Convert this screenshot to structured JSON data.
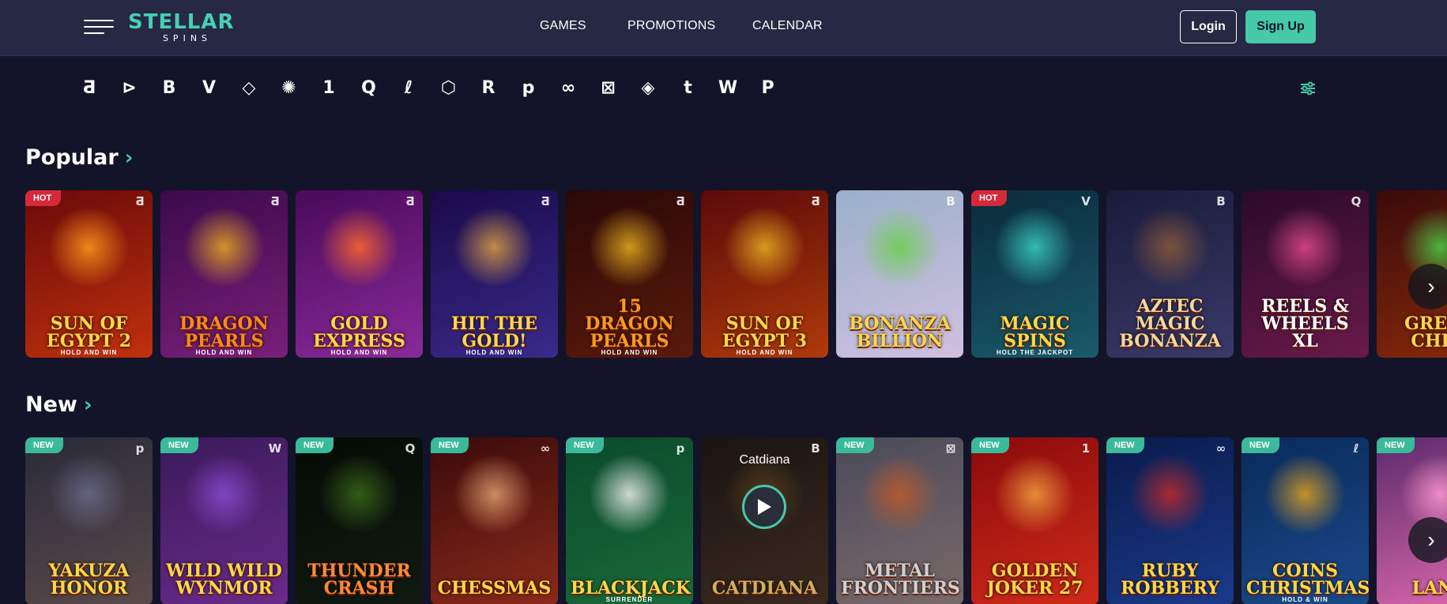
{
  "header": {
    "logo_top": "STELLAR",
    "logo_bottom": "SPINS",
    "nav": [
      "GAMES",
      "PROMOTIONS",
      "CALENDAR"
    ],
    "login_label": "Login",
    "signup_label": "Sign Up"
  },
  "providers": [
    "Ƌ",
    "⊳",
    "B",
    "V",
    "◇",
    "✺",
    "1",
    "Q",
    "ℓ",
    "⬡",
    "R",
    "p",
    "∞",
    "⊠",
    "◈",
    "t",
    "W",
    "P"
  ],
  "popular": {
    "title": "Popular",
    "chevron": "›",
    "games": [
      {
        "name": "SUN OF EGYPT 2",
        "sub": "HOLD AND WIN",
        "badge": "HOT",
        "provider": "Ƌ",
        "bg": [
          "#6a0a0a",
          "#c0310c"
        ],
        "glow": "#ff9a1a",
        "color": "#ffd84a"
      },
      {
        "name": "DRAGON PEARLS",
        "sub": "HOLD AND WIN",
        "badge": "",
        "provider": "Ƌ",
        "bg": [
          "#3b0a4a",
          "#7a1f7a"
        ],
        "glow": "#e6a91d",
        "color": "#ff8a1a"
      },
      {
        "name": "GOLD EXPRESS",
        "sub": "HOLD AND WIN",
        "badge": "",
        "provider": "Ƌ",
        "bg": [
          "#4a0a5a",
          "#8a2a9a"
        ],
        "glow": "#ff6a2a",
        "color": "#ffd84a"
      },
      {
        "name": "HIT THE GOLD!",
        "sub": "HOLD AND WIN",
        "badge": "",
        "provider": "Ƌ",
        "bg": [
          "#1a0a4a",
          "#3a2a8a"
        ],
        "glow": "#d9a040",
        "color": "#ffd84a"
      },
      {
        "name": "15 DRAGON PEARLS",
        "sub": "HOLD AND WIN",
        "badge": "",
        "provider": "Ƌ",
        "bg": [
          "#2a0808",
          "#5a1a0a"
        ],
        "glow": "#e6b020",
        "color": "#ff9a1a"
      },
      {
        "name": "SUN OF EGYPT 3",
        "sub": "HOLD AND WIN",
        "badge": "",
        "provider": "Ƌ",
        "bg": [
          "#5a0a0a",
          "#b03a0a"
        ],
        "glow": "#e6b020",
        "color": "#ffd84a"
      },
      {
        "name": "BONANZA BILLION",
        "sub": "",
        "badge": "",
        "provider": "B",
        "bg": [
          "#9ab0c8",
          "#d0c0e0"
        ],
        "glow": "#6ad04a",
        "color": "#ffd84a"
      },
      {
        "name": "MAGIC SPINS",
        "sub": "HOLD THE JACKPOT",
        "badge": "HOT",
        "provider": "V",
        "bg": [
          "#0a2a3a",
          "#1a5a6a"
        ],
        "glow": "#3ad0c0",
        "color": "#ffd84a"
      },
      {
        "name": "AZTEC MAGIC BONANZA",
        "sub": "",
        "badge": "",
        "provider": "B",
        "bg": [
          "#1a1a3a",
          "#3a3a6a"
        ],
        "glow": "#8a5a3a",
        "color": "#f0d8a0"
      },
      {
        "name": "REELS & WHEELS XL",
        "sub": "",
        "badge": "",
        "provider": "Q",
        "bg": [
          "#2a0a2a",
          "#6a1a4a"
        ],
        "glow": "#e04a8a",
        "color": "#ffffff"
      },
      {
        "name": "GREEN CHILI",
        "sub": "",
        "badge": "",
        "provider": "",
        "bg": [
          "#3a0a0a",
          "#8a2a0a"
        ],
        "glow": "#4ad04a",
        "color": "#ffd84a"
      }
    ]
  },
  "new": {
    "title": "New",
    "chevron": "›",
    "games": [
      {
        "name": "YAKUZA HONOR",
        "sub": "",
        "badge": "NEW",
        "provider": "p",
        "bg": [
          "#2a2a3a",
          "#5a4a4a"
        ],
        "glow": "#6a6a8a",
        "color": "#ffd84a"
      },
      {
        "name": "WILD WILD WYNMOR",
        "sub": "",
        "badge": "NEW",
        "provider": "W",
        "bg": [
          "#3a1a5a",
          "#6a2a8a"
        ],
        "glow": "#8a4ad0",
        "color": "#ffd84a"
      },
      {
        "name": "THUNDER CRASH",
        "sub": "",
        "badge": "NEW",
        "provider": "Q",
        "bg": [
          "#050a05",
          "#101a10"
        ],
        "glow": "#3a6a1a",
        "color": "#ff8a3a"
      },
      {
        "name": "CHESSMAS",
        "sub": "",
        "badge": "NEW",
        "provider": "∞",
        "bg": [
          "#3a0a0a",
          "#8a2a1a"
        ],
        "glow": "#e0a070",
        "color": "#ffd84a"
      },
      {
        "name": "BLACKJACK",
        "sub": "SURRENDER",
        "badge": "NEW",
        "provider": "p",
        "bg": [
          "#0a4a2a",
          "#1a6a3a"
        ],
        "glow": "#f0f0f0",
        "color": "#ffd84a"
      },
      {
        "name": "CATDIANA",
        "sub": "",
        "badge": "",
        "provider": "B",
        "bg": [
          "#1a1410",
          "#3a2a20"
        ],
        "glow": "#5a4020",
        "color": "#d0b060"
      },
      {
        "name": "METAL FRONTIERS",
        "sub": "",
        "badge": "NEW",
        "provider": "⊠",
        "bg": [
          "#4a4a5a",
          "#7a6a6a"
        ],
        "glow": "#c05a2a",
        "color": "#d0d0d0"
      },
      {
        "name": "GOLDEN JOKER 27",
        "sub": "",
        "badge": "NEW",
        "provider": "1",
        "bg": [
          "#8a0a0a",
          "#d02a1a"
        ],
        "glow": "#f0a040",
        "color": "#ffd84a"
      },
      {
        "name": "RUBY ROBBERY",
        "sub": "",
        "badge": "NEW",
        "provider": "∞",
        "bg": [
          "#0a1a4a",
          "#1a3a8a"
        ],
        "glow": "#c02a2a",
        "color": "#ffd84a"
      },
      {
        "name": "COINS CHRISTMAS",
        "sub": "HOLD & WIN",
        "badge": "NEW",
        "provider": "ℓ",
        "bg": [
          "#0a2a5a",
          "#1a4a8a"
        ],
        "glow": "#e0a020",
        "color": "#ffd84a"
      },
      {
        "name": "LAND",
        "sub": "",
        "badge": "NEW",
        "provider": "",
        "bg": [
          "#5a2a6a",
          "#e06ab0"
        ],
        "glow": "#ff9ad0",
        "color": "#ffd84a"
      }
    ],
    "featured_provider_label": "Catdiana"
  },
  "arrow": "›"
}
